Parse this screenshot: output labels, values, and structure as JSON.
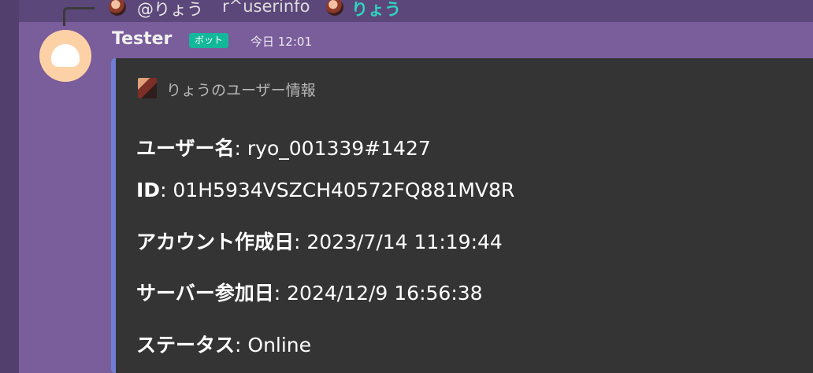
{
  "reply": {
    "mention": "@りょう",
    "command": "r^userinfo",
    "target_name": "りょう",
    "mention_color": "#e8e8e8",
    "target_color": "#2fd3c0"
  },
  "message": {
    "author": "Tester",
    "bot_tag": "ボット",
    "timestamp": "今日 12:01",
    "avatar_color": "#fdd1a6"
  },
  "embed": {
    "accent_color": "#6f7fd6",
    "author_name": "りょうのユーザー情報",
    "fields": [
      {
        "name": "ユーザー名",
        "value": ": ryo_001339#1427"
      },
      {
        "name": "ID",
        "value": ": 01H5934VSZCH40572FQ881MV8R"
      },
      {
        "name": "アカウント作成日",
        "value": ": 2023/7/14 11:19:44"
      },
      {
        "name": "サーバー参加日",
        "value": ": 2024/12/9 16:56:38"
      },
      {
        "name": "ステータス",
        "value": ": Online"
      }
    ]
  }
}
